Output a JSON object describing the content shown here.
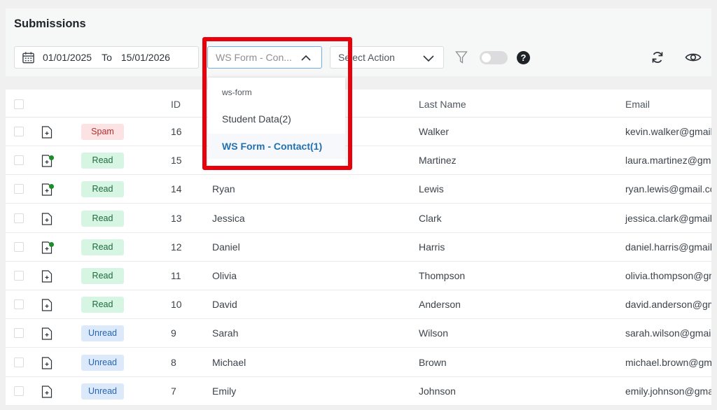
{
  "header": {
    "title": "Submissions"
  },
  "filters": {
    "date_from": "01/01/2025",
    "to_label": "To",
    "date_to": "15/01/2026",
    "form_select_value": "WS Form - Con...",
    "action_select_value": "Select Action"
  },
  "dropdown": {
    "group_label": "ws-form",
    "options": [
      "Student Data(2)",
      "WS Form - Contact(1)"
    ],
    "selected": "WS Form - Contact(1)"
  },
  "table": {
    "columns": [
      "ID",
      "Last Name",
      "Email"
    ],
    "rows": [
      {
        "status": "Spam",
        "id": "16",
        "first": "",
        "last": "Walker",
        "email": "kevin.walker@gmail.com",
        "dot": false
      },
      {
        "status": "Read",
        "id": "15",
        "first": "",
        "last": "Martinez",
        "email": "laura.martinez@gmail.com",
        "dot": true
      },
      {
        "status": "Read",
        "id": "14",
        "first": "Ryan",
        "last": "Lewis",
        "email": "ryan.lewis@gmail.com",
        "dot": true
      },
      {
        "status": "Read",
        "id": "13",
        "first": "Jessica",
        "last": "Clark",
        "email": "jessica.clark@gmail.com",
        "dot": false
      },
      {
        "status": "Read",
        "id": "12",
        "first": "Daniel",
        "last": "Harris",
        "email": "daniel.harris@gmail.com",
        "dot": true
      },
      {
        "status": "Read",
        "id": "11",
        "first": "Olivia",
        "last": "Thompson",
        "email": "olivia.thompson@gmail.com",
        "dot": false
      },
      {
        "status": "Read",
        "id": "10",
        "first": "David",
        "last": "Anderson",
        "email": "david.anderson@gmail.com",
        "dot": false
      },
      {
        "status": "Unread",
        "id": "9",
        "first": "Sarah",
        "last": "Wilson",
        "email": "sarah.wilson@gmail.com",
        "dot": false
      },
      {
        "status": "Unread",
        "id": "8",
        "first": "Michael",
        "last": "Brown",
        "email": "michael.brown@gmail.com",
        "dot": false
      },
      {
        "status": "Unread",
        "id": "7",
        "first": "Emily",
        "last": "Johnson",
        "email": "emily.johnson@gmail.com",
        "dot": false
      }
    ]
  },
  "icons": [
    "calendar-icon",
    "chevron-up-icon",
    "chevron-down-icon",
    "filter-icon",
    "help-icon",
    "refresh-icon",
    "eye-icon",
    "document-icon"
  ],
  "colors": {
    "highlight": "#e8000a",
    "accent": "#2271b1",
    "spam": "#b32d2e",
    "read": "#1e6a3d",
    "unread": "#2865b0"
  }
}
